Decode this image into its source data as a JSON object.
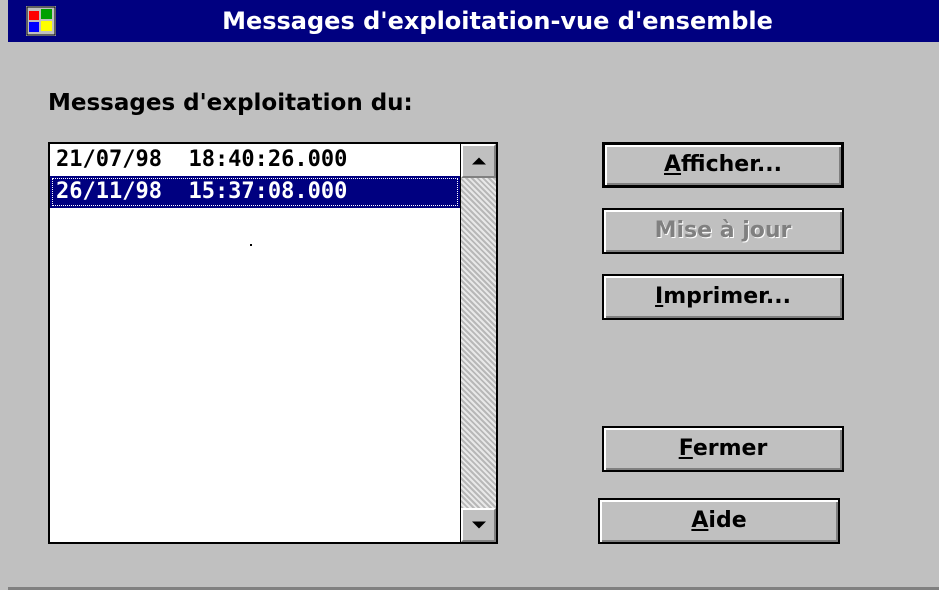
{
  "window": {
    "title": "Messages d'exploitation-vue d'ensemble",
    "sysmenu_icon": "windows-flag-icon"
  },
  "prompt": "Messages d'exploitation du:",
  "listbox": {
    "items": [
      {
        "text": "21/07/98  18:40:26.000",
        "selected": false
      },
      {
        "text": "26/11/98  15:37:08.000",
        "selected": true
      }
    ],
    "scroll_up_icon": "scroll-up-arrow-icon",
    "scroll_down_icon": "scroll-down-arrow-icon"
  },
  "buttons": {
    "afficher": {
      "mnemonic": "A",
      "rest": "fficher...",
      "enabled": true
    },
    "mise_a_jour": {
      "label": "Mise à jour",
      "enabled": false
    },
    "imprimer": {
      "mnemonic": "I",
      "rest": "mprimer...",
      "enabled": true
    },
    "fermer": {
      "mnemonic": "F",
      "rest": "ermer",
      "enabled": true
    },
    "aide": {
      "mnemonic": "A",
      "rest": "ide",
      "enabled": true
    }
  },
  "colors": {
    "titlebar": "#000080",
    "face": "#c0c0c0",
    "selection": "#000080"
  }
}
